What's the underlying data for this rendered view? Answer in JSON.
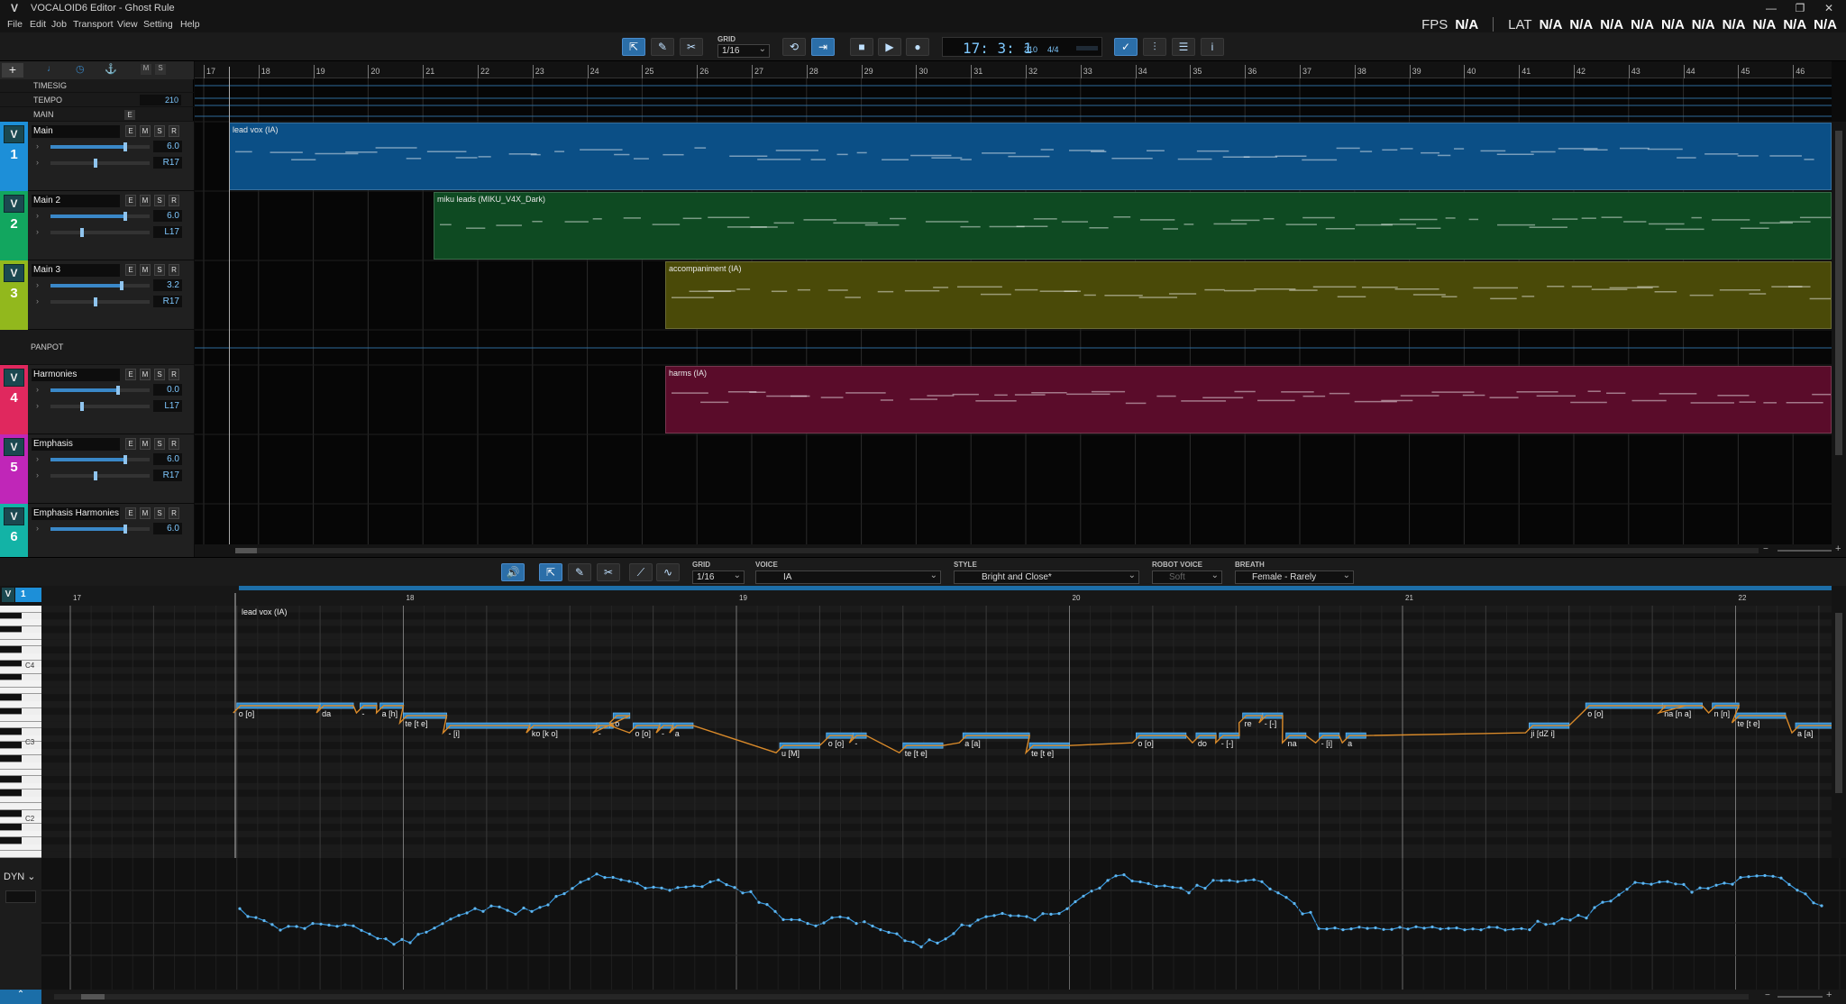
{
  "window": {
    "title": "VOCALOID6 Editor - Ghost Rule",
    "logo": "V"
  },
  "menu": [
    "File",
    "Edit",
    "Job",
    "Transport",
    "View",
    "Setting",
    "Help"
  ],
  "perf": {
    "fps_label": "FPS",
    "fps_value": "N/A",
    "lat_label": "LAT",
    "lat_values": [
      "N/A",
      "N/A",
      "N/A",
      "N/A",
      "N/A",
      "N/A",
      "N/A",
      "N/A",
      "N/A",
      "N/A"
    ]
  },
  "toolbar": {
    "grid_label": "GRID",
    "grid_value": "1/16",
    "time": "17: 3: 1",
    "bpm": "210",
    "signature": "4/4"
  },
  "global_rows": [
    {
      "label": "TIMESIG",
      "value": ""
    },
    {
      "label": "TEMPO",
      "value": "210"
    },
    {
      "label": "MAIN",
      "value": ""
    }
  ],
  "tracks": [
    {
      "num": "1",
      "name": "Main",
      "volume": "6.0",
      "pan": "R17",
      "color": "#1d8fd8",
      "vol_pct": 0.75,
      "pan_pct": 0.45
    },
    {
      "num": "2",
      "name": "Main 2",
      "volume": "6.0",
      "pan": "L17",
      "color": "#12a65f",
      "vol_pct": 0.75,
      "pan_pct": 0.32
    },
    {
      "num": "3",
      "name": "Main 3",
      "volume": "3.2",
      "pan": "R17",
      "color": "#92b81d",
      "vol_pct": 0.72,
      "pan_pct": 0.45
    },
    {
      "num": "4",
      "name": "Harmonies",
      "volume": "0.0",
      "pan": "L17",
      "color": "#e0285e",
      "vol_pct": 0.68,
      "pan_pct": 0.32
    },
    {
      "num": "5",
      "name": "Emphasis",
      "volume": "6.0",
      "pan": "R17",
      "color": "#c026b8",
      "vol_pct": 0.75,
      "pan_pct": 0.45
    },
    {
      "num": "6",
      "name": "Emphasis Harmonies",
      "volume": "6.0",
      "pan": "",
      "color": "#13b3a6",
      "vol_pct": 0.75,
      "pan_pct": 0.45
    }
  ],
  "panpot_label": "PANPOT",
  "ems_buttons": [
    "E",
    "M",
    "S",
    "R"
  ],
  "ruler_bars": [
    "17",
    "18",
    "19",
    "20",
    "21",
    "22",
    "23",
    "24",
    "25",
    "26",
    "27",
    "28",
    "29",
    "30",
    "31",
    "32",
    "33",
    "34",
    "35",
    "36",
    "37",
    "38",
    "39",
    "40",
    "41",
    "42",
    "43",
    "44",
    "45",
    "46"
  ],
  "parts": [
    {
      "label": "lead vox (IA)",
      "color": "#0b4f86"
    },
    {
      "label": "miku leads (MIKU_V4X_Dark)",
      "color": "#0e4a22"
    },
    {
      "label": "accompaniment (IA)",
      "color": "#4a4a08"
    },
    {
      "label": "harms (IA)",
      "color": "#5a0c2a"
    }
  ],
  "editor": {
    "grid_label": "GRID",
    "grid_value": "1/16",
    "voice_label": "VOICE",
    "voice_value": "IA",
    "style_label": "STYLE",
    "style_value": "Bright and Close*",
    "robot_label": "ROBOT VOICE",
    "robot_value": "Soft",
    "breath_label": "BREATH",
    "breath_value": "Female - Rarely",
    "track_v": "V",
    "track_num": "1",
    "part_label": "lead vox (IA)",
    "bars": [
      "17",
      "18",
      "19",
      "20",
      "21",
      "22"
    ],
    "key_labels": [
      "C4",
      "C3",
      "C2"
    ],
    "dyn_label": "DYN"
  },
  "notes": [
    {
      "lyric": "o [o]",
      "bar": 17.5,
      "len": 0.25,
      "pitch": 0
    },
    {
      "lyric": "da",
      "bar": 17.75,
      "len": 0.1,
      "pitch": 0
    },
    {
      "lyric": "-",
      "bar": 17.87,
      "len": 0.05,
      "pitch": 0
    },
    {
      "lyric": "a [h]",
      "bar": 17.93,
      "len": 0.07,
      "pitch": 0
    },
    {
      "lyric": "te [t e]",
      "bar": 18.0,
      "len": 0.13,
      "pitch": -1
    },
    {
      "lyric": "- [i]",
      "bar": 18.13,
      "len": 0.25,
      "pitch": -2
    },
    {
      "lyric": "ko [k o]",
      "bar": 18.38,
      "len": 0.25,
      "pitch": -2
    },
    {
      "lyric": "o",
      "bar": 18.63,
      "len": 0.05,
      "pitch": -1
    },
    {
      "lyric": "-",
      "bar": 18.58,
      "len": 0.04,
      "pitch": -2
    },
    {
      "lyric": "o [o]",
      "bar": 18.69,
      "len": 0.08,
      "pitch": -2
    },
    {
      "lyric": "-",
      "bar": 18.77,
      "len": 0.04,
      "pitch": -2
    },
    {
      "lyric": "a",
      "bar": 18.81,
      "len": 0.06,
      "pitch": -2
    },
    {
      "lyric": "u [M]",
      "bar": 19.13,
      "len": 0.12,
      "pitch": -4
    },
    {
      "lyric": "o [o]",
      "bar": 19.27,
      "len": 0.08,
      "pitch": -3
    },
    {
      "lyric": "-",
      "bar": 19.35,
      "len": 0.04,
      "pitch": -3
    },
    {
      "lyric": "te [t e]",
      "bar": 19.5,
      "len": 0.12,
      "pitch": -4
    },
    {
      "lyric": "a [a]",
      "bar": 19.68,
      "len": 0.2,
      "pitch": -3
    },
    {
      "lyric": "te [t e]",
      "bar": 19.88,
      "len": 0.12,
      "pitch": -4
    },
    {
      "lyric": "o [o]",
      "bar": 20.2,
      "len": 0.15,
      "pitch": -3
    },
    {
      "lyric": "do",
      "bar": 20.38,
      "len": 0.06,
      "pitch": -3
    },
    {
      "lyric": "- [-]",
      "bar": 20.45,
      "len": 0.06,
      "pitch": -3
    },
    {
      "lyric": "re",
      "bar": 20.52,
      "len": 0.06,
      "pitch": -1
    },
    {
      "lyric": "- [-]",
      "bar": 20.58,
      "len": 0.06,
      "pitch": -1
    },
    {
      "lyric": "na",
      "bar": 20.65,
      "len": 0.06,
      "pitch": -3
    },
    {
      "lyric": "- [i]",
      "bar": 20.75,
      "len": 0.06,
      "pitch": -3
    },
    {
      "lyric": "a",
      "bar": 20.83,
      "len": 0.06,
      "pitch": -3
    },
    {
      "lyric": "ji [dZ i]",
      "bar": 21.38,
      "len": 0.12,
      "pitch": -2
    },
    {
      "lyric": "o [o]",
      "bar": 21.55,
      "len": 0.3,
      "pitch": 0
    },
    {
      "lyric": "na [n a]",
      "bar": 21.78,
      "len": 0.12,
      "pitch": 0
    },
    {
      "lyric": "n [n]",
      "bar": 21.93,
      "len": 0.08,
      "pitch": 0
    },
    {
      "lyric": "te [t e]",
      "bar": 22.0,
      "len": 0.15,
      "pitch": -1
    },
    {
      "lyric": "a [a]",
      "bar": 22.18,
      "len": 0.12,
      "pitch": -2
    }
  ]
}
